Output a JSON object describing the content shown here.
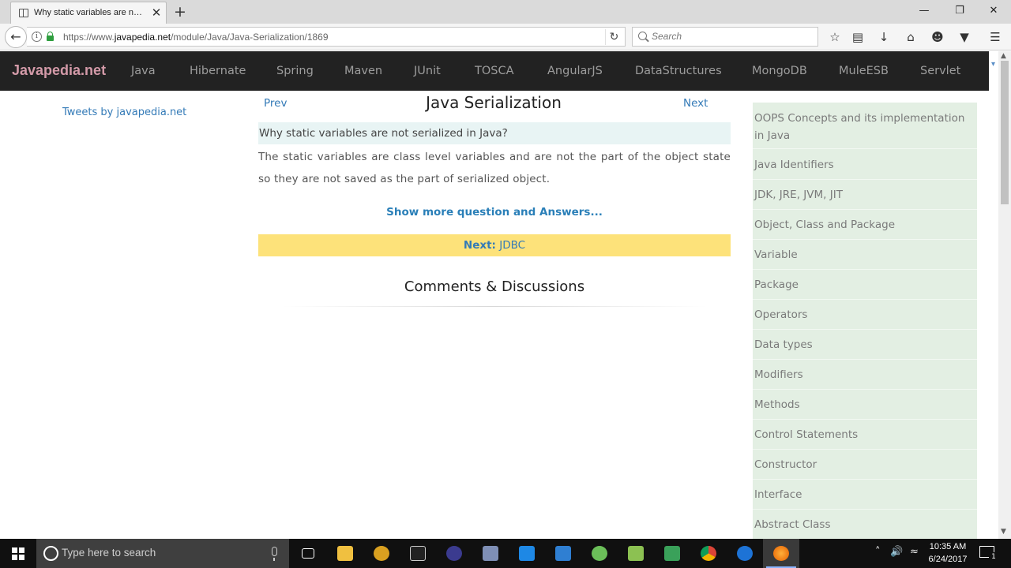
{
  "browser": {
    "tab_title": "Why static variables are not serialized in Java?",
    "tab_close": "✕",
    "new_tab": "+",
    "url_prefix": "https://www.",
    "url_host": "javapedia.net",
    "url_path": "/module/Java/Java-Serialization/1869",
    "search_placeholder": "Search",
    "window_controls": {
      "minimize": "—",
      "restore": "❐",
      "close": "✕"
    }
  },
  "site": {
    "brand": "Javapedia.net",
    "nav": [
      "Java",
      "Hibernate",
      "Spring",
      "Maven",
      "JUnit",
      "TOSCA",
      "AngularJS",
      "DataStructures",
      "MongoDB",
      "MuleESB",
      "Servlet"
    ]
  },
  "main": {
    "tweets_link": "Tweets by javapedia.net",
    "prev": "Prev",
    "next": "Next",
    "title": "Java Serialization",
    "question": "Why static variables are not serialized in Java?",
    "answer": "The static variables are class level variables and are not the part of the object state so they are not saved as the part of serialized object.",
    "more_link": "Show more question and Answers...",
    "next_label": "Next:",
    "next_topic": "JDBC",
    "comments_title": "Comments & Discussions"
  },
  "sidebar": {
    "items": [
      "OOPS Concepts and its implementation in Java",
      "Java Identifiers",
      "JDK, JRE, JVM, JIT",
      "Object, Class and Package",
      "Variable",
      "Package",
      "Operators",
      "Data types",
      "Modifiers",
      "Methods",
      "Control Statements",
      "Constructor",
      "Interface",
      "Abstract Class"
    ]
  },
  "taskbar": {
    "search_placeholder": "Type here to search",
    "time": "10:35 AM",
    "date": "6/24/2017",
    "notification_count": "1"
  },
  "colors": {
    "header_bg": "#222222",
    "brand": "#d39aa8",
    "link": "#337ab7",
    "sidebar_bg": "#e3efe3",
    "next_banner_bg": "#fde27a",
    "question_bg": "#e8f4f4"
  },
  "icons": {
    "toolbar": [
      "star-icon",
      "reading-list-icon",
      "download-icon",
      "home-icon",
      "chat-icon",
      "pocket-icon",
      "menu-icon"
    ],
    "taskbar_apps": [
      "task-view-icon",
      "file-explorer-icon",
      "java-app-icon",
      "terminal-icon",
      "eclipse-icon",
      "network-icon",
      "screen-icon",
      "visual-studio-icon",
      "android-icon",
      "notepad-icon",
      "photos-icon",
      "chrome-icon",
      "edge-icon",
      "firefox-icon"
    ]
  }
}
